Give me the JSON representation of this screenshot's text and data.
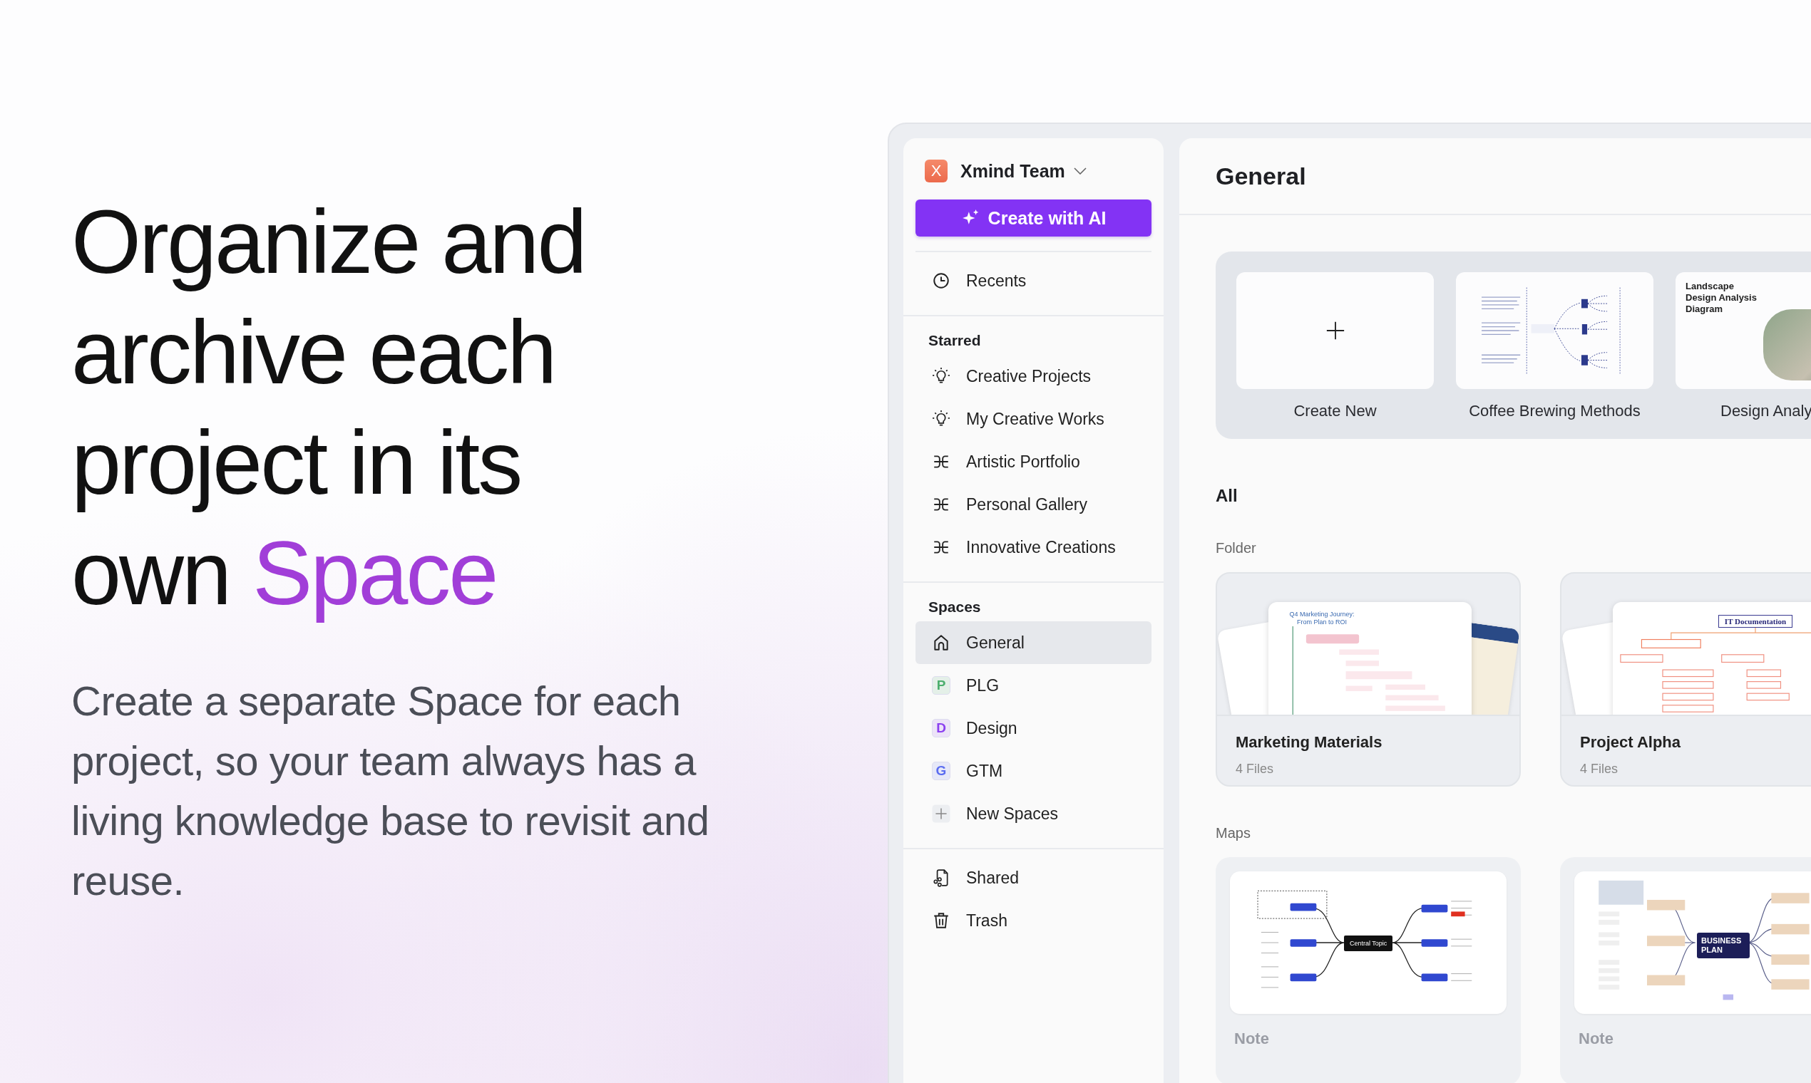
{
  "hero": {
    "headline": "Organize and archive each project in its own",
    "highlight": "Space",
    "subtitle": "Create a separate Space for each project, so your team always has a living knowledge base to revisit and reuse."
  },
  "sidebar": {
    "team": {
      "logo_letter": "X",
      "name": "Xmind Team"
    },
    "ai_button": "Create with AI",
    "recents": "Recents",
    "starred": {
      "heading": "Starred",
      "items": [
        {
          "label": "Creative Projects",
          "kind": "bulb"
        },
        {
          "label": "My Creative Works",
          "kind": "bulb"
        },
        {
          "label": "Artistic Portfolio",
          "kind": "map"
        },
        {
          "label": "Personal Gallery",
          "kind": "map"
        },
        {
          "label": "Innovative Creations",
          "kind": "map"
        }
      ]
    },
    "spaces": {
      "heading": "Spaces",
      "items": [
        {
          "label": "General",
          "kind": "home",
          "selected": true
        },
        {
          "label": "PLG",
          "kind": "letter",
          "letter": "P",
          "color": "#4caf6e",
          "selected": false
        },
        {
          "label": "Design",
          "kind": "letter",
          "letter": "D",
          "color": "#8b3ff0",
          "selected": false
        },
        {
          "label": "GTM",
          "kind": "letter",
          "letter": "G",
          "color": "#5a6cf0",
          "selected": false
        },
        {
          "label": "New Spaces",
          "kind": "add",
          "selected": false
        }
      ]
    },
    "footer_items": [
      {
        "label": "Shared",
        "kind": "shared"
      },
      {
        "label": "Trash",
        "kind": "trash"
      }
    ]
  },
  "main": {
    "title": "General",
    "templates": [
      {
        "label": "Create New",
        "kind": "new"
      },
      {
        "label": "Coffee Brewing Methods",
        "kind": "diagram"
      },
      {
        "label": "Design Analy",
        "kind": "landscape",
        "preview_title": "Landscape Design Analysis Diagram"
      }
    ],
    "section": "All",
    "folder_heading": "Folder",
    "folders": [
      {
        "name": "Marketing Materials",
        "count": "4 Files",
        "kind": "journey",
        "preview_title": "Q4 Marketing Journey: From Plan to ROI"
      },
      {
        "name": "Project Alpha",
        "count": "4 Files",
        "kind": "docs",
        "preview_title": "IT Documentation"
      }
    ],
    "maps_heading": "Maps",
    "maps": [
      {
        "label": "Note",
        "kind": "topic",
        "preview_title": "Central Topic"
      },
      {
        "label": "Note",
        "kind": "plan",
        "preview_title": "BUSINESS PLAN"
      }
    ]
  }
}
